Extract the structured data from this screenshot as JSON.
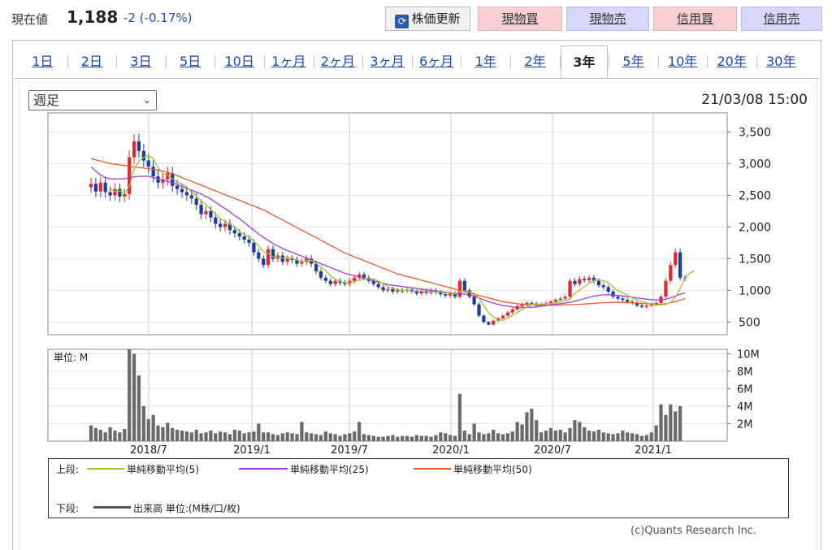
{
  "header": {
    "price_label": "現在値",
    "price_value": "1,188",
    "price_change": "-2 (-0.17%)",
    "refresh_label": "株価更新",
    "buttons": [
      {
        "label": "現物買",
        "color": "#f9cfd6"
      },
      {
        "label": "現物売",
        "color": "#d7d8fb"
      },
      {
        "label": "信用買",
        "color": "#f9cfd6"
      },
      {
        "label": "信用売",
        "color": "#d7d8fb"
      }
    ]
  },
  "tabs": [
    "1日",
    "2日",
    "3日",
    "5日",
    "10日",
    "1ヶ月",
    "2ヶ月",
    "3ヶ月",
    "6ヶ月",
    "1年",
    "2年",
    "3年",
    "5年",
    "10年",
    "20年",
    "30年"
  ],
  "active_tab": "3年",
  "period_select": "週足",
  "datetime": "21/03/08 15:00",
  "colors": {
    "up": "#e8262d",
    "down": "#1c3d9e",
    "ma5": "#9bc22d",
    "ma25": "#a63ad9",
    "ma50": "#ee5a2a",
    "volume": "#6a6a6a"
  },
  "chart_data": {
    "type": "candlestick",
    "x_tick_labels": [
      "2018/7",
      "2019/1",
      "2019/7",
      "2020/1",
      "2020/7",
      "2021/1"
    ],
    "price_axis": {
      "ticks": [
        3500,
        3000,
        2500,
        2000,
        1500,
        1000,
        500
      ],
      "ylim": [
        300,
        3800
      ]
    },
    "volume_axis": {
      "unit_label": "単位: M",
      "ticks": [
        10,
        8,
        6,
        4,
        2
      ],
      "tick_labels": [
        "10M",
        "8M",
        "6M",
        "4M",
        "2M"
      ],
      "ylim": [
        0,
        10.5
      ]
    },
    "close": [
      2680,
      2560,
      2700,
      2550,
      2500,
      2600,
      2480,
      2520,
      3100,
      3350,
      3200,
      3050,
      2950,
      2800,
      2700,
      2750,
      2850,
      2650,
      2600,
      2550,
      2500,
      2450,
      2350,
      2200,
      2250,
      2150,
      2050,
      2000,
      2050,
      1950,
      1900,
      1850,
      1800,
      1750,
      1600,
      1500,
      1400,
      1650,
      1500,
      1550,
      1450,
      1500,
      1480,
      1420,
      1450,
      1500,
      1420,
      1300,
      1200,
      1150,
      1100,
      1150,
      1120,
      1100,
      1150,
      1200,
      1250,
      1200,
      1150,
      1100,
      1050,
      1000,
      1020,
      980,
      1000,
      990,
      1010,
      980,
      950,
      990,
      960,
      1000,
      970,
      940,
      920,
      950,
      900,
      1150,
      1000,
      900,
      780,
      600,
      500,
      460,
      520,
      560,
      600,
      650,
      700,
      750,
      780,
      800,
      790,
      760,
      780,
      800,
      820,
      850,
      870,
      900,
      1150,
      1100,
      1180,
      1160,
      1200,
      1150,
      1080,
      1050,
      980,
      900,
      870,
      850,
      820,
      800,
      760,
      740,
      760,
      780,
      800,
      900,
      1150,
      1400,
      1600,
      1200,
      1188
    ],
    "ma5": [
      null,
      null,
      null,
      null,
      2600,
      2560,
      2570,
      2530,
      2640,
      2910,
      3040,
      3100,
      3130,
      3080,
      2940,
      2850,
      2810,
      2760,
      2710,
      2680,
      2630,
      2550,
      2490,
      2410,
      2350,
      2280,
      2200,
      2130,
      2090,
      2040,
      1990,
      1930,
      1880,
      1840,
      1780,
      1700,
      1610,
      1580,
      1530,
      1520,
      1510,
      1530,
      1500,
      1480,
      1460,
      1470,
      1470,
      1430,
      1370,
      1310,
      1230,
      1180,
      1140,
      1120,
      1120,
      1140,
      1160,
      1180,
      1190,
      1180,
      1150,
      1100,
      1060,
      1030,
      1010,
      1000,
      1000,
      990,
      990,
      990,
      980,
      980,
      980,
      970,
      960,
      960,
      940,
      980,
      990,
      980,
      950,
      880,
      760,
      650,
      580,
      530,
      530,
      560,
      610,
      650,
      700,
      740,
      770,
      780,
      780,
      790,
      790,
      800,
      820,
      840,
      860,
      950,
      1000,
      1060,
      1110,
      1160,
      1170,
      1150,
      1120,
      1050,
      1000,
      960,
      920,
      880,
      850,
      830,
      800,
      780,
      770,
      770,
      780,
      810,
      890,
      1030,
      1190,
      1270,
      1310
    ],
    "ma25": [
      2950,
      2880,
      2820,
      2780,
      2760,
      2760,
      2760,
      2760,
      2780,
      2790,
      2800,
      2800,
      2800,
      2780,
      2760,
      2740,
      2720,
      2700,
      2670,
      2640,
      2610,
      2580,
      2550,
      2520,
      2480,
      2440,
      2390,
      2340,
      2290,
      2240,
      2180,
      2130,
      2070,
      2010,
      1950,
      1890,
      1840,
      1790,
      1740,
      1700,
      1660,
      1630,
      1600,
      1570,
      1540,
      1510,
      1480,
      1450,
      1420,
      1390,
      1360,
      1330,
      1300,
      1270,
      1250,
      1230,
      1210,
      1190,
      1170,
      1150,
      1130,
      1110,
      1090,
      1080,
      1070,
      1060,
      1050,
      1040,
      1030,
      1020,
      1010,
      1000,
      990,
      980,
      970,
      960,
      950,
      945,
      940,
      930,
      910,
      880,
      850,
      820,
      800,
      780,
      760,
      750,
      740,
      730,
      730,
      730,
      735,
      740,
      750,
      760,
      770,
      780,
      790,
      800,
      810,
      830,
      850,
      870,
      890,
      910,
      920,
      930,
      930,
      925,
      920,
      910,
      900,
      890,
      880,
      870,
      860,
      855,
      850,
      850,
      860,
      880,
      910,
      940,
      960
    ],
    "ma50": [
      3080,
      3060,
      3040,
      3020,
      3000,
      2990,
      2980,
      2970,
      2960,
      2950,
      2940,
      2930,
      2920,
      2910,
      2900,
      2880,
      2860,
      2840,
      2810,
      2780,
      2750,
      2720,
      2690,
      2660,
      2630,
      2600,
      2570,
      2540,
      2510,
      2480,
      2450,
      2420,
      2390,
      2360,
      2330,
      2300,
      2270,
      2230,
      2190,
      2150,
      2110,
      2070,
      2030,
      1990,
      1950,
      1910,
      1870,
      1830,
      1790,
      1750,
      1710,
      1670,
      1630,
      1590,
      1560,
      1530,
      1500,
      1470,
      1440,
      1410,
      1380,
      1350,
      1320,
      1290,
      1260,
      1240,
      1220,
      1200,
      1180,
      1160,
      1140,
      1120,
      1100,
      1080,
      1060,
      1040,
      1020,
      1000,
      980,
      960,
      940,
      920,
      900,
      880,
      860,
      840,
      820,
      810,
      800,
      790,
      780,
      775,
      770,
      768,
      766,
      765,
      765,
      766,
      768,
      770,
      772,
      775,
      780,
      785,
      790,
      795,
      800,
      805,
      808,
      810,
      810,
      810,
      808,
      805,
      800,
      795,
      790,
      785,
      780,
      780,
      790,
      805,
      825,
      845,
      870
    ],
    "volume": [
      1.8,
      1.5,
      1.3,
      1.0,
      1.6,
      1.2,
      1.0,
      1.4,
      10.5,
      10.0,
      7.5,
      4.0,
      2.5,
      3.0,
      1.8,
      1.6,
      2.1,
      1.5,
      1.3,
      1.2,
      1.1,
      1.0,
      1.3,
      0.9,
      1.0,
      1.2,
      0.9,
      1.1,
      1.0,
      0.8,
      1.3,
      1.2,
      0.9,
      1.0,
      1.1,
      2.0,
      1.0,
      1.0,
      0.8,
      0.7,
      0.9,
      1.0,
      0.9,
      0.8,
      2.2,
      1.0,
      0.9,
      0.8,
      0.7,
      1.1,
      0.9,
      0.8,
      0.6,
      0.8,
      0.9,
      1.1,
      2.2,
      0.8,
      0.7,
      0.6,
      0.5,
      0.5,
      0.6,
      0.7,
      0.5,
      0.6,
      0.6,
      0.5,
      0.7,
      0.6,
      0.6,
      0.5,
      0.7,
      1.0,
      0.9,
      0.7,
      0.6,
      5.4,
      1.2,
      0.8,
      2.0,
      1.0,
      0.8,
      0.9,
      1.3,
      0.9,
      0.8,
      0.9,
      1.1,
      2.2,
      1.9,
      3.3,
      3.7,
      2.4,
      1.0,
      1.2,
      1.5,
      1.2,
      1.3,
      1.0,
      1.5,
      2.4,
      2.2,
      1.6,
      1.2,
      1.1,
      1.3,
      1.0,
      0.9,
      0.8,
      0.9,
      1.2,
      1.0,
      0.9,
      0.8,
      0.6,
      0.7,
      1.0,
      1.8,
      4.2,
      3.0,
      4.2,
      3.4,
      4.0
    ],
    "legend": {
      "top_label": "上段:",
      "bottom_label": "下段:",
      "ma5": "単純移動平均(5)",
      "ma25": "単純移動平均(25)",
      "ma50": "単純移動平均(50)",
      "volume": "出来高 単位:(M株/口/枚)"
    }
  },
  "credit": "(c)Quants Research Inc."
}
